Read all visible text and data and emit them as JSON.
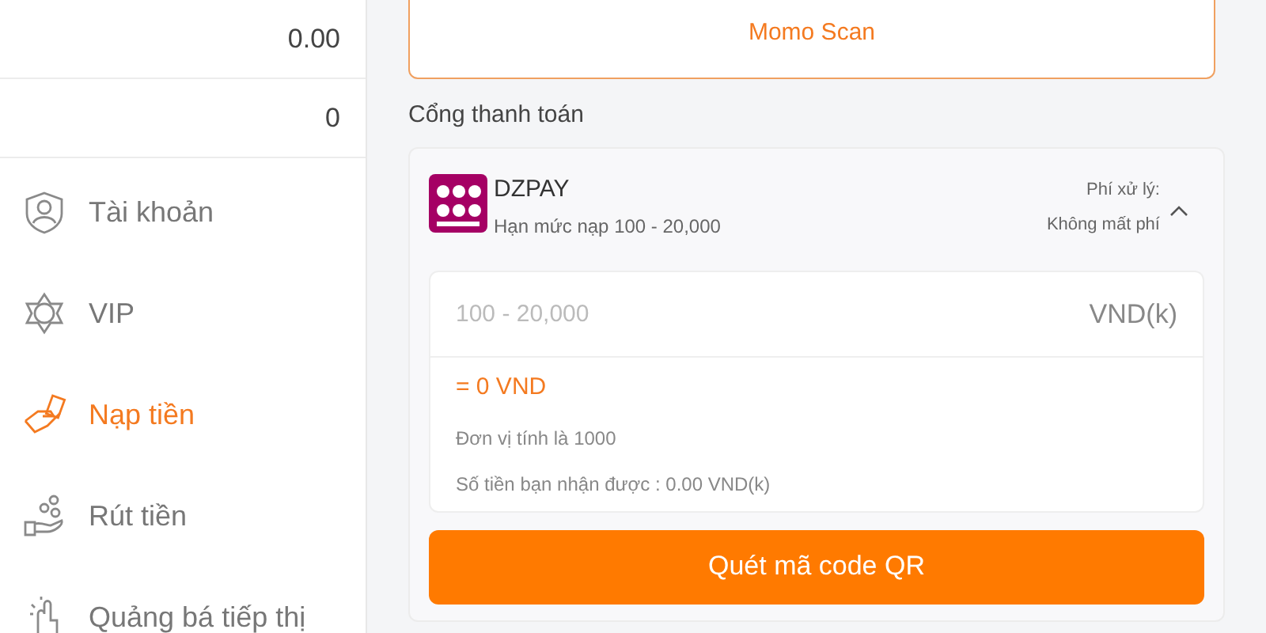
{
  "balances": [
    {
      "value": "0.00"
    },
    {
      "value": "0"
    }
  ],
  "menu": [
    {
      "label": "Tài khoản",
      "kind": "account",
      "selected": false
    },
    {
      "label": "VIP",
      "kind": "vip",
      "selected": false
    },
    {
      "label": "Nạp tiền",
      "kind": "deposit",
      "selected": true
    },
    {
      "label": "Rút tiền",
      "kind": "withdraw",
      "selected": false
    },
    {
      "label": "Quảng bá tiếp thị",
      "kind": "promote",
      "selected": false
    }
  ],
  "scan_button": "Momo Scan",
  "gateway_title": "Cổng thanh toán",
  "method": {
    "name": "DZPAY",
    "limit": "Hạn mức nạp 100 - 20,000",
    "fee_label": "Phí xử lý:",
    "fee_value": "Không mất phí",
    "expanded": true
  },
  "amount": {
    "placeholder": "100 - 20,000",
    "unit": "VND(k)"
  },
  "converted": "= 0 VND",
  "notes": [
    "Đơn vị tính là 1000",
    "Số tiền bạn nhận được : 0.00 VND(k)"
  ],
  "submit": "Quét mã code QR"
}
